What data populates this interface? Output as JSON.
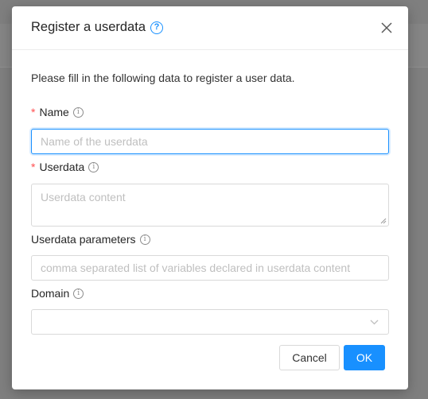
{
  "modal": {
    "title": "Register a userdata",
    "title_help_icon": "?",
    "intro": "Please fill in the following data to register a user data."
  },
  "form": {
    "name": {
      "label": "Name",
      "required_mark": "*",
      "placeholder": "Name of the userdata"
    },
    "userdata": {
      "label": "Userdata",
      "required_mark": "*",
      "placeholder": "Userdata content"
    },
    "parameters": {
      "label": "Userdata parameters",
      "placeholder": "comma separated list of variables declared in userdata content"
    },
    "domain": {
      "label": "Domain",
      "selected": ""
    },
    "info_glyph": "i"
  },
  "buttons": {
    "cancel": "Cancel",
    "ok": "OK"
  },
  "icons": [
    "question-circle-icon",
    "close-icon",
    "info-circle-icon",
    "chevron-down-icon",
    "resize-grip-icon"
  ],
  "colors": {
    "primary": "#1890ff",
    "required": "#ff4d4f",
    "focus_border": "#1890ff"
  }
}
